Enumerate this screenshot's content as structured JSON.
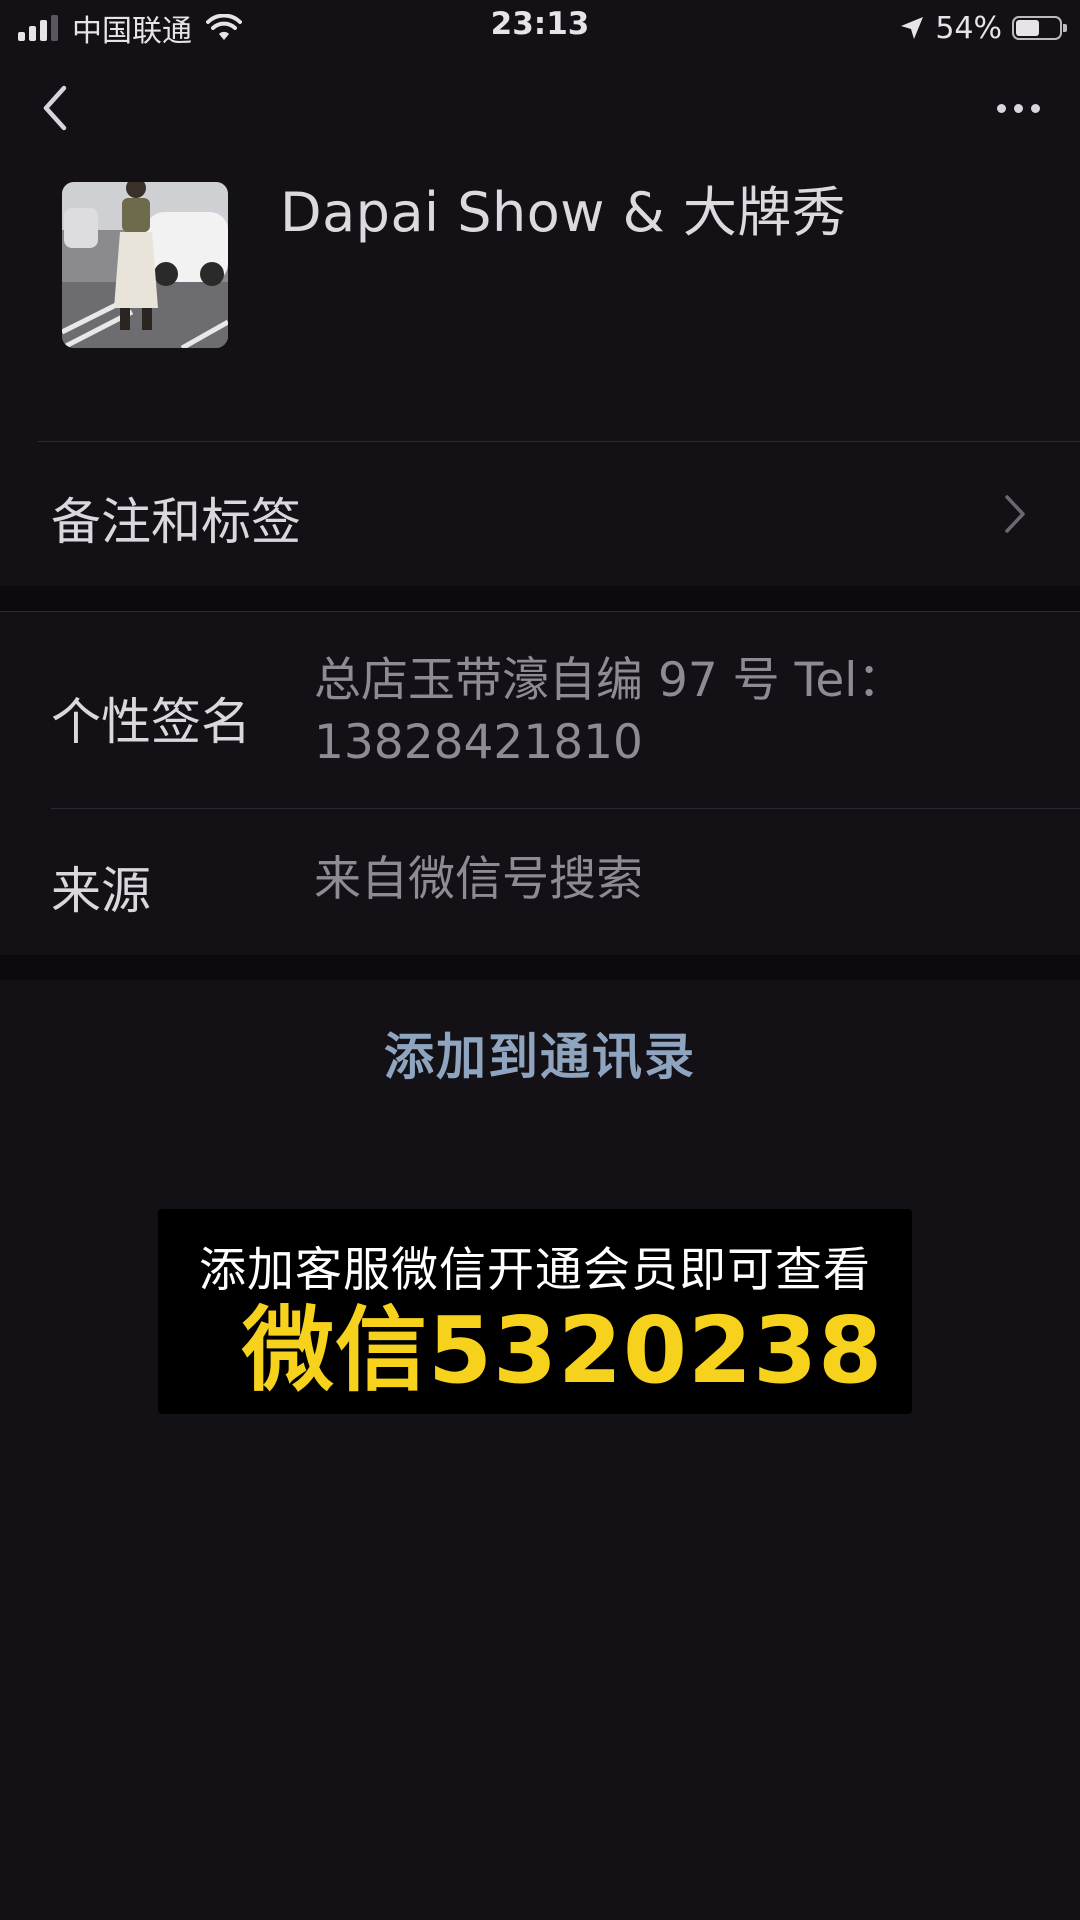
{
  "status_bar": {
    "carrier": "中国联通",
    "time": "23:13",
    "battery_percent": "54%",
    "battery_level": 0.54,
    "signal_bars": 3,
    "signal_total": 4
  },
  "profile": {
    "name": "Dapai Show & 大牌秀"
  },
  "rows": {
    "remarks_label": "备注和标签",
    "signature_label": "个性签名",
    "signature_line1": "总店玉带濠自编 97 号  Tel：",
    "signature_line2": "13828421810",
    "source_label": "来源",
    "source_value": "来自微信号搜索"
  },
  "actions": {
    "add_contact": "添加到通讯录"
  },
  "banner": {
    "line1": "添加客服微信开通会员即可查看",
    "line2": "微信5320238",
    "accent_color": "#f7d21c"
  }
}
